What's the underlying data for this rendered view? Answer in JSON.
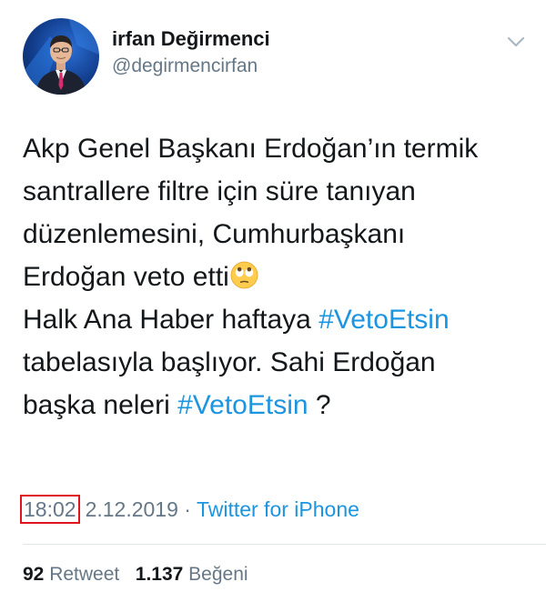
{
  "tweet": {
    "author": {
      "display_name": "irfan Değirmenci",
      "handle": "@degirmencirfan"
    },
    "icons": {
      "menu": "chevron-down-icon",
      "emoji": "face-with-rolling-eyes-emoji"
    },
    "text": {
      "line1": "Akp Genel Başkanı Erdoğan’ın termik",
      "line2": "santrallere filtre için süre tanıyan",
      "line3": "düzenlemesini, Cumhurbaşkanı",
      "line4": "Erdoğan veto etti",
      "line5_prefix": "Halk Ana Haber haftaya ",
      "line5_hashtag": "#VetoEtsin",
      "line6": "tabelasıyla başlıyor. Sahi Erdoğan",
      "line7_prefix": "başka neleri ",
      "line7_hashtag": "#VetoEtsin",
      "line7_suffix": " ?"
    },
    "meta": {
      "time": "18:02",
      "date": "2.12.2019",
      "separator": "·",
      "source": "Twitter for iPhone"
    },
    "stats": {
      "retweets_count": "92",
      "retweets_label": "Retweet",
      "likes_count": "1.137",
      "likes_label": "Beğeni"
    },
    "colors": {
      "hashtag": "#1b95e0",
      "secondary_text": "#657786",
      "highlight_box": "#e0141e",
      "divider": "#e1e8ed"
    }
  }
}
